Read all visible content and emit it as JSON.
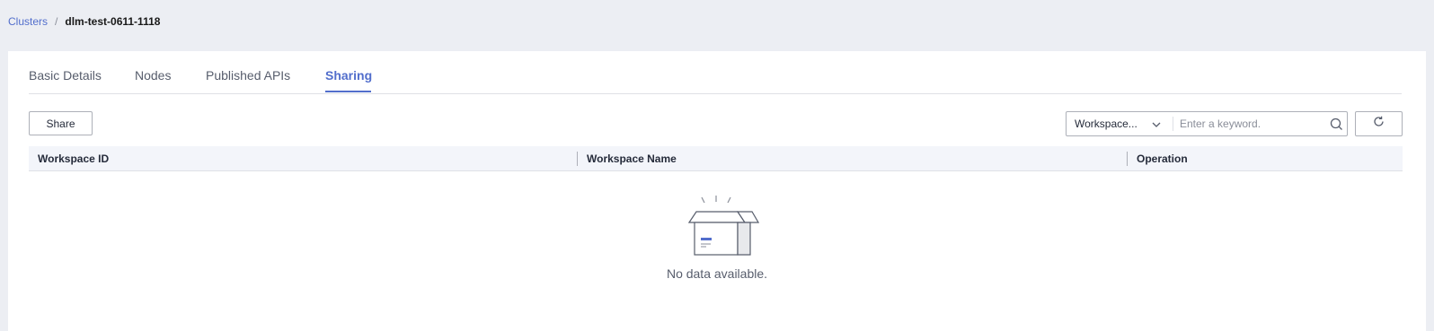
{
  "breadcrumb": {
    "parent": "Clusters",
    "separator": "/",
    "current": "dlm-test-0611-1118"
  },
  "tabs": [
    {
      "label": "Basic Details",
      "active": false
    },
    {
      "label": "Nodes",
      "active": false
    },
    {
      "label": "Published APIs",
      "active": false
    },
    {
      "label": "Sharing",
      "active": true
    }
  ],
  "toolbar": {
    "share_label": "Share",
    "filter_select_value": "Workspace...",
    "search_placeholder": "Enter a keyword."
  },
  "table": {
    "columns": [
      "Workspace ID",
      "Workspace Name",
      "Operation"
    ],
    "rows": [],
    "empty_text": "No data available."
  },
  "colors": {
    "accent": "#526ecc",
    "header_bg": "#f3f5fa",
    "page_bg": "#eceef3"
  },
  "icons": [
    "chevron-down-icon",
    "search-icon",
    "refresh-icon",
    "empty-box-icon"
  ]
}
